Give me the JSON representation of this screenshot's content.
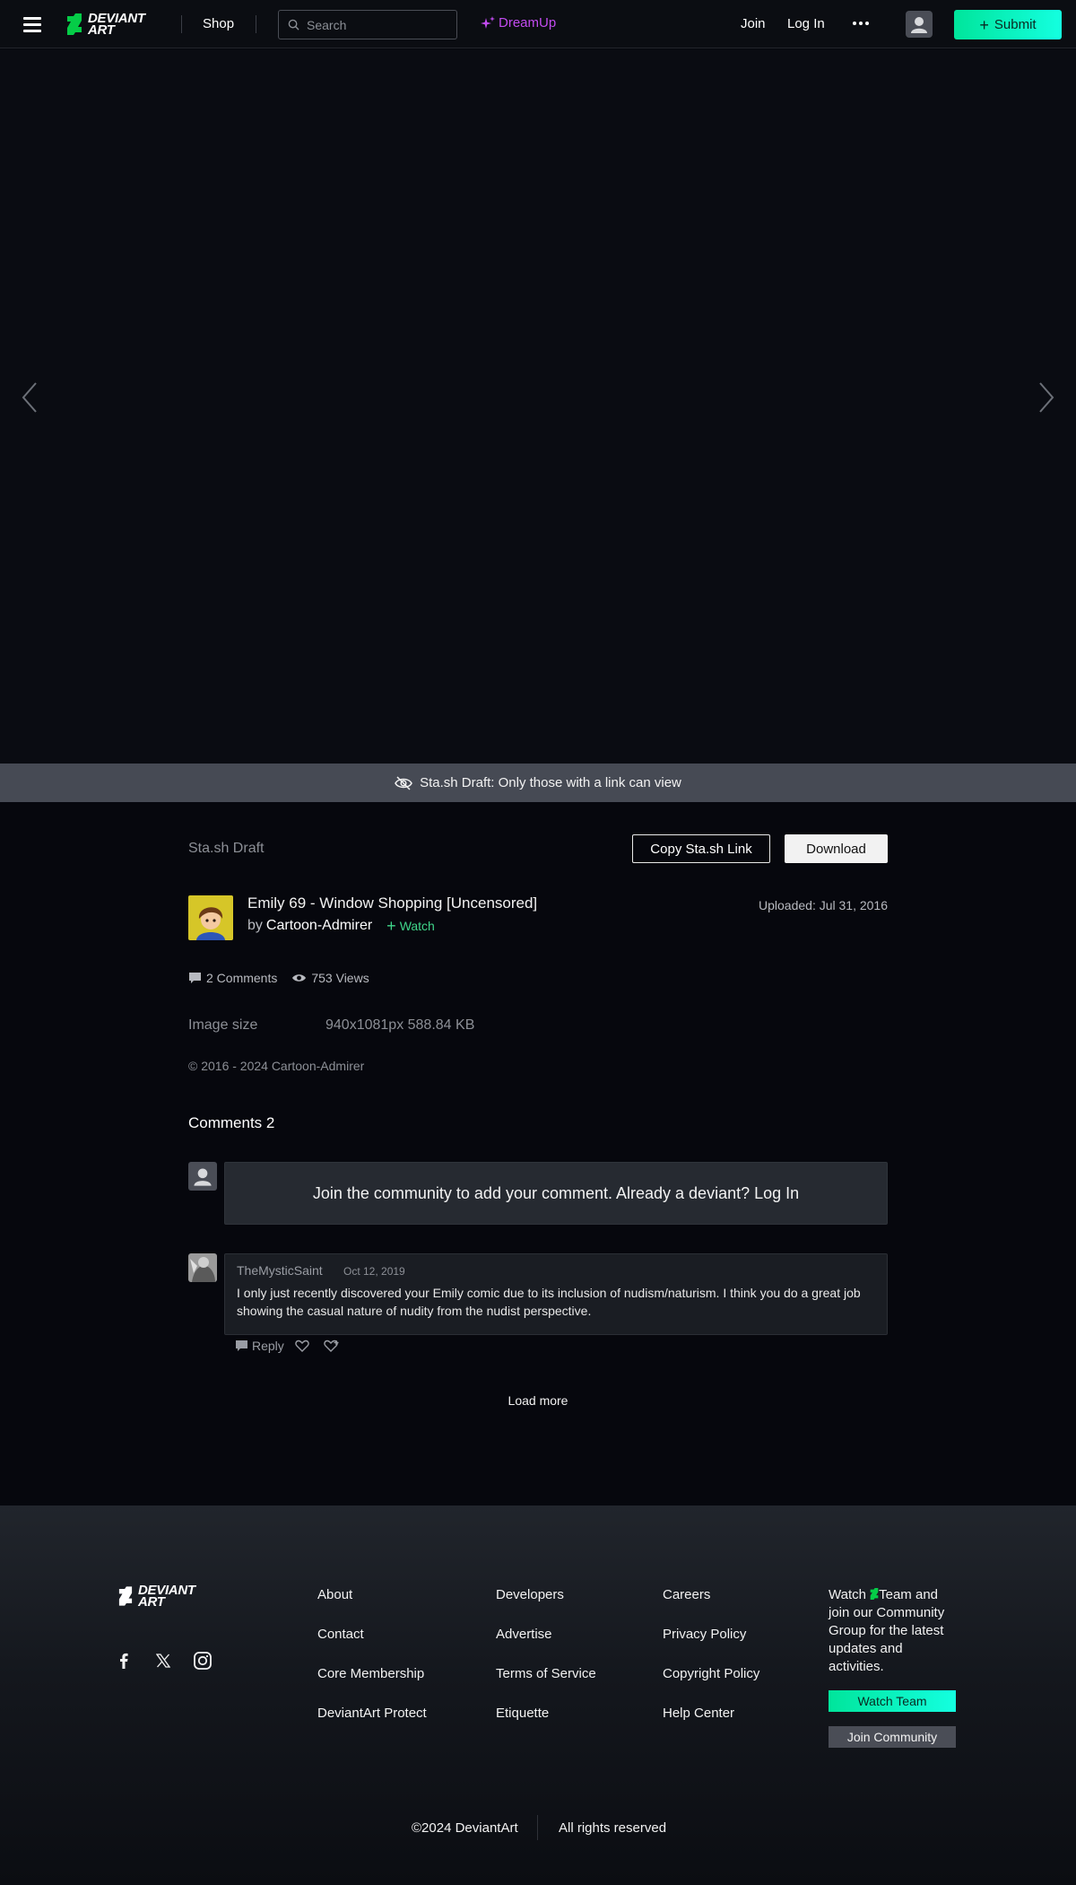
{
  "header": {
    "logo_text_line1": "DEVIANT",
    "logo_text_line2": "ART",
    "shop": "Shop",
    "search_placeholder": "Search",
    "dreamup": "DreamUp",
    "join": "Join",
    "login": "Log In",
    "submit": "Submit"
  },
  "draft_bar": {
    "text": "Sta.sh Draft: Only those with a link can view"
  },
  "deviation": {
    "stash_label": "Sta.sh Draft",
    "copy_link": "Copy Sta.sh Link",
    "download": "Download",
    "title": "Emily 69 - Window Shopping [Uncensored]",
    "by": "by",
    "author": "Cartoon-Admirer",
    "watch": "Watch",
    "uploaded": "Uploaded: Jul 31, 2016",
    "comments_stat": "2 Comments",
    "views_stat": "753 Views",
    "image_size_label": "Image size",
    "image_size_value": "940x1081px 588.84 KB",
    "copyright": "© 2016 - 2024 Cartoon-Admirer"
  },
  "comments": {
    "heading": "Comments 2",
    "join_prompt": "Join the community to add your comment. Already a deviant?",
    "join_login": "Log In",
    "items": [
      {
        "user": "TheMysticSaint",
        "date": "Oct 12, 2019",
        "body": "I only just recently discovered your Emily comic due to its inclusion of nudism/naturism. I think you do a great job showing the casual nature of nudity from the nudist perspective.",
        "reply": "Reply"
      }
    ],
    "load_more": "Load more"
  },
  "footer": {
    "col1": [
      "About",
      "Contact",
      "Core Membership",
      "DeviantArt Protect"
    ],
    "col2": [
      "Developers",
      "Advertise",
      "Terms of Service",
      "Etiquette"
    ],
    "col3": [
      "Careers",
      "Privacy Policy",
      "Copyright Policy",
      "Help Center"
    ],
    "watch_text_1": "Watch",
    "watch_text_2": "Team and join our Community Group for the latest updates and activities.",
    "watch_team": "Watch Team",
    "join_community": "Join Community",
    "copyright": "©2024 DeviantArt",
    "rights": "All rights reserved"
  },
  "colors": {
    "accent_green": "#00e59b",
    "dreamup_purple": "#c24bf0",
    "watch_green": "#3fd58a",
    "background": "#06070d"
  }
}
